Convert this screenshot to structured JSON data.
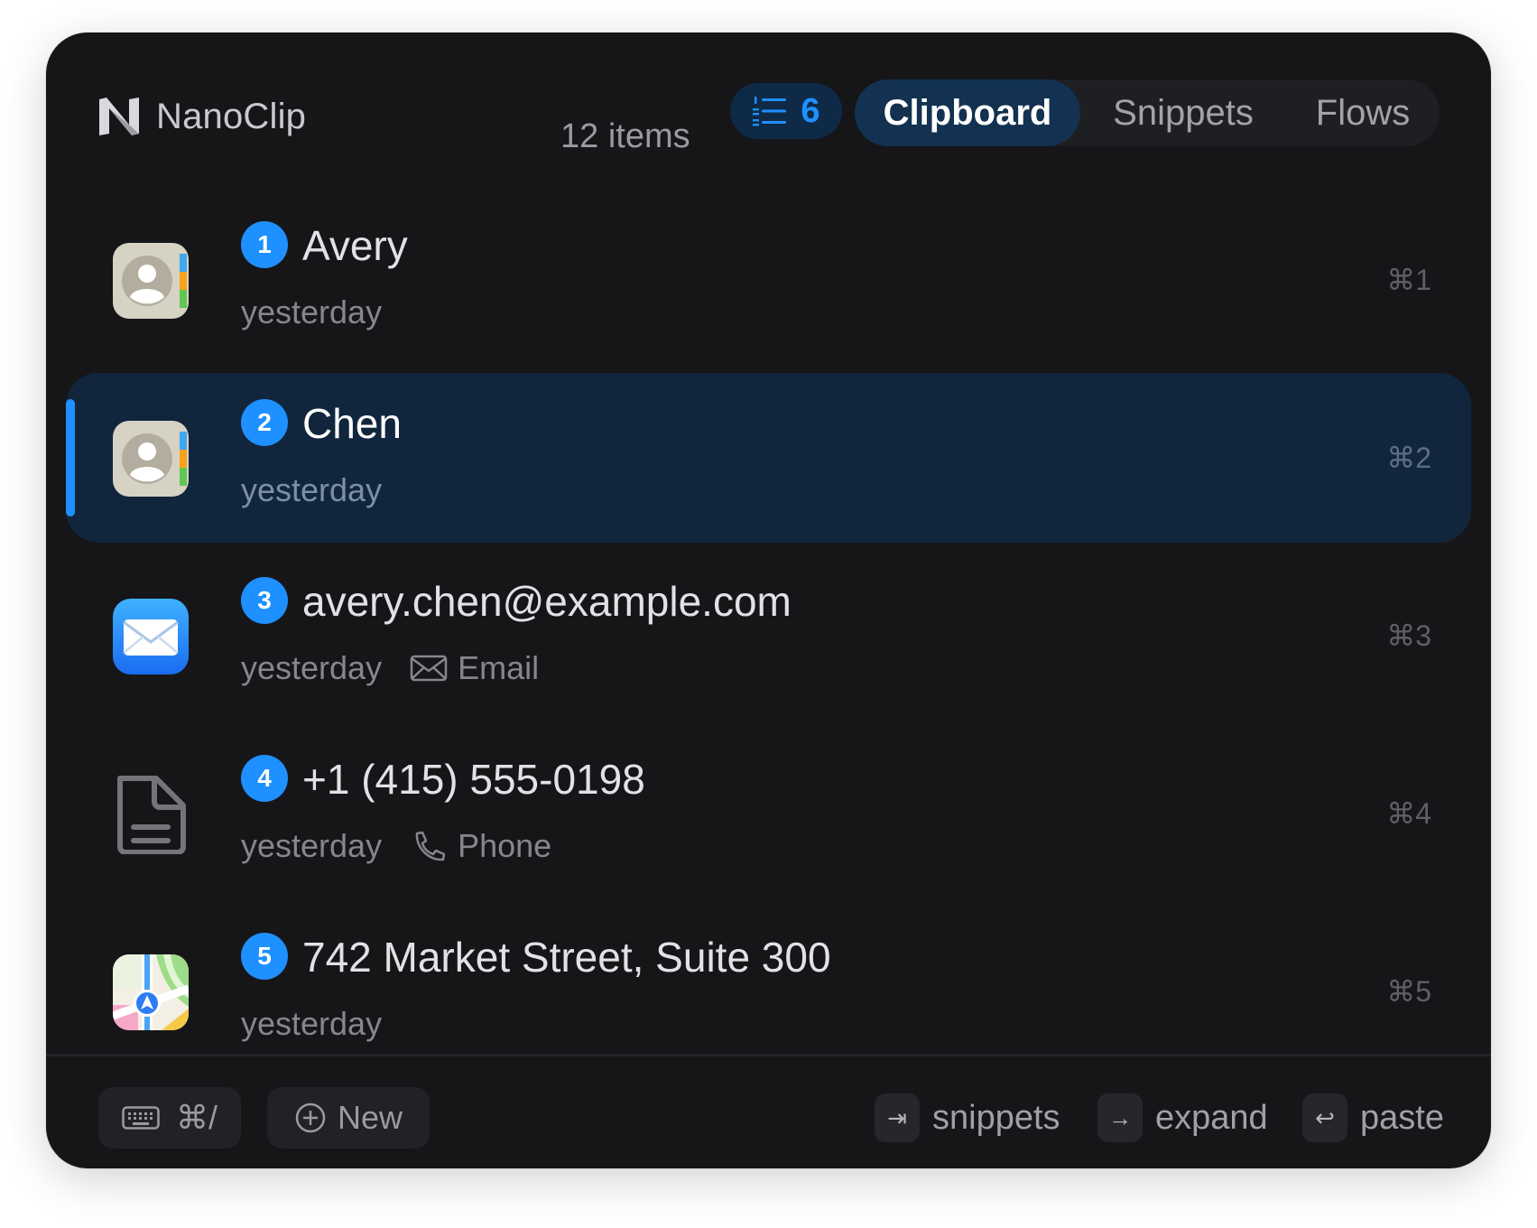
{
  "app": {
    "name": "NanoClip"
  },
  "header": {
    "item_count": "12 items",
    "stack_count": "6",
    "tabs": [
      {
        "label": "Clipboard",
        "active": true
      },
      {
        "label": "Snippets",
        "active": false
      },
      {
        "label": "Flows",
        "active": false
      }
    ]
  },
  "items": [
    {
      "index": "1",
      "title": "Avery",
      "time": "yesterday",
      "kind": "",
      "icon": "contacts-icon",
      "shortcut": "⌘1",
      "selected": false
    },
    {
      "index": "2",
      "title": "Chen",
      "time": "yesterday",
      "kind": "",
      "icon": "contacts-icon",
      "shortcut": "⌘2",
      "selected": true
    },
    {
      "index": "3",
      "title": "avery.chen@example.com",
      "time": "yesterday",
      "kind": "Email",
      "kind_icon": "envelope-icon",
      "icon": "mail-app-icon",
      "shortcut": "⌘3",
      "selected": false
    },
    {
      "index": "4",
      "title": "+1 (415) 555-0198",
      "time": "yesterday",
      "kind": "Phone",
      "kind_icon": "phone-icon",
      "icon": "document-icon",
      "shortcut": "⌘4",
      "selected": false
    },
    {
      "index": "5",
      "title": "742 Market Street, Suite 300",
      "time": "yesterday",
      "kind": "",
      "icon": "maps-app-icon",
      "shortcut": "⌘5",
      "selected": false
    }
  ],
  "footer": {
    "shortcuts_label": "⌘/",
    "new_label": "New",
    "hints": [
      {
        "key": "⇥",
        "label": "snippets"
      },
      {
        "key": "→",
        "label": "expand"
      },
      {
        "key": "↩",
        "label": "paste"
      }
    ]
  },
  "colors": {
    "window_bg": "#161618",
    "accent": "#1e90ff",
    "selected_row": "#11263d",
    "active_tab": "#133150"
  }
}
